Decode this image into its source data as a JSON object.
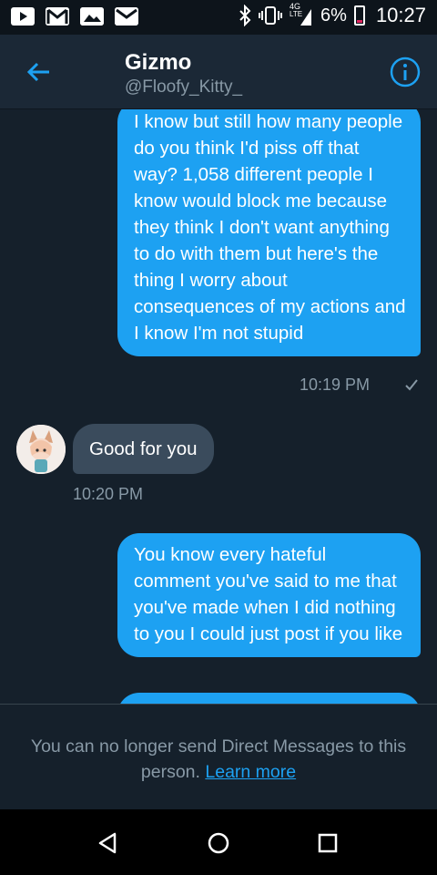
{
  "status_bar": {
    "network_label": "4G",
    "network_sub": "LTE",
    "battery": "6%",
    "time": "10:27"
  },
  "header": {
    "name": "Gizmo",
    "handle": "@Floofy_Kitty_"
  },
  "messages": [
    {
      "direction": "outgoing",
      "text": "I know but still how many people do you think I'd piss off that way? 1,058 different people I know would block me because they think I don't want anything to do with them but here's the thing I worry about consequences of my actions and I know I'm not stupid",
      "time": "10:19 PM"
    },
    {
      "direction": "incoming",
      "text": "Good for you",
      "time": "10:20 PM"
    },
    {
      "direction": "outgoing",
      "text": "You know every hateful comment you've said to me that you've made when I did nothing to you I could just post if you like"
    }
  ],
  "footer": {
    "notice": "You can no longer send Direct Messages to this person.",
    "link": "Learn more"
  },
  "colors": {
    "accent": "#1da1f2",
    "background": "#15202b",
    "incoming_bubble": "#3a4b5c",
    "muted_text": "#8899a6"
  },
  "icons": {
    "back": "arrow-left-icon",
    "info": "info-icon",
    "nav": [
      "back-triangle-icon",
      "home-circle-icon",
      "recents-square-icon"
    ]
  }
}
